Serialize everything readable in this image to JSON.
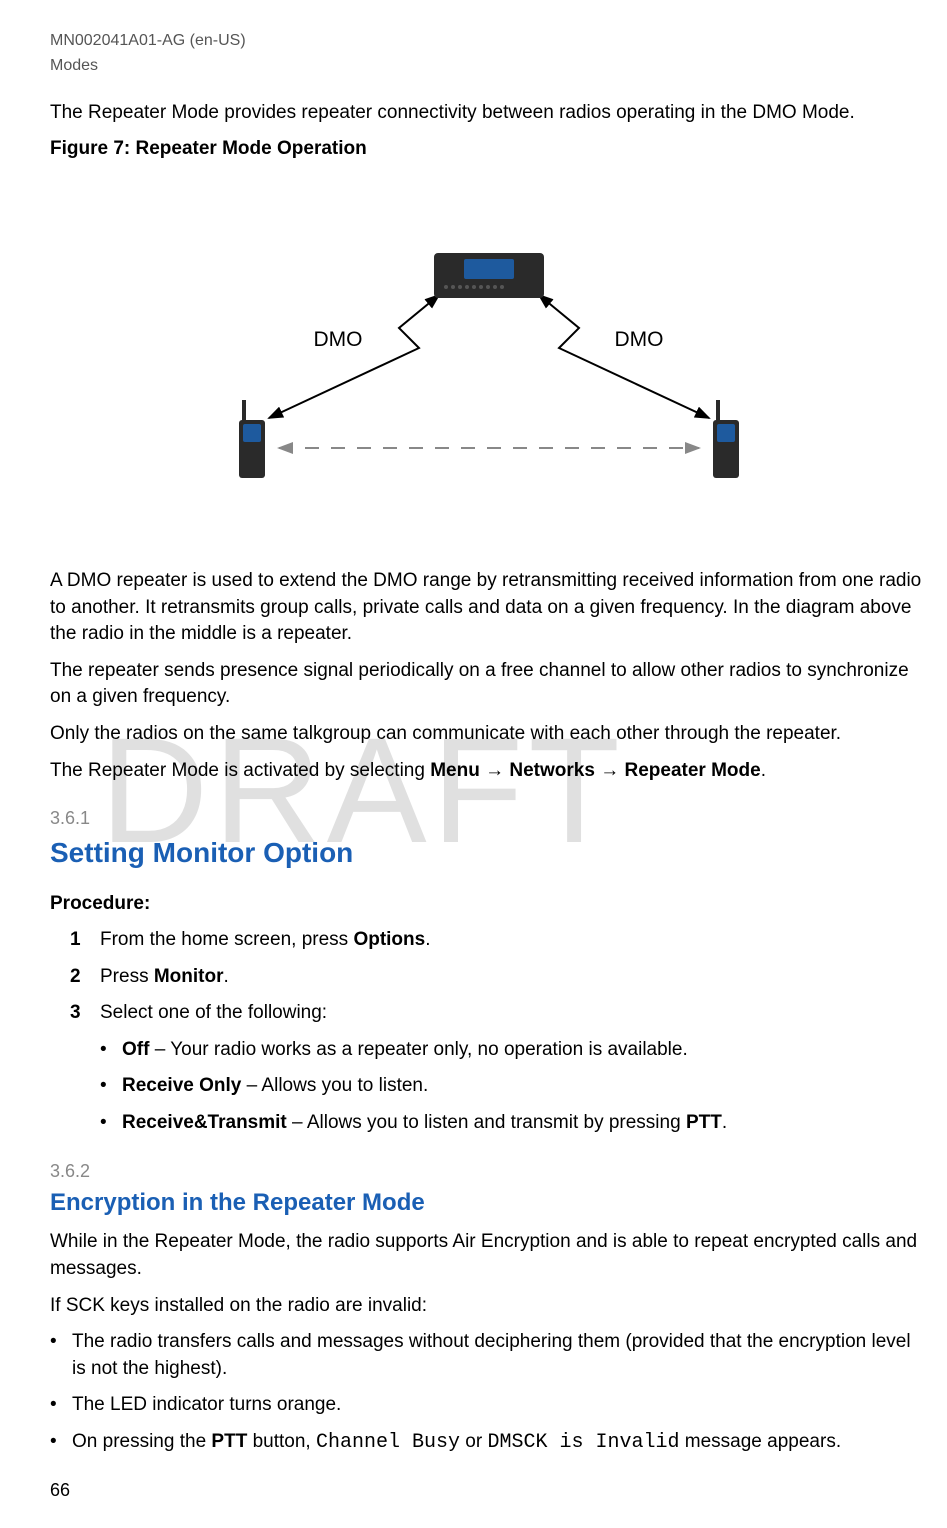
{
  "header": {
    "doc_id": "MN002041A01-AG (en-US)",
    "section": "Modes"
  },
  "page_number": "66",
  "watermark": "DRAFT",
  "intro_text": "The Repeater Mode provides repeater connectivity between radios operating in the DMO Mode.",
  "figure_title": "Figure 7: Repeater Mode Operation",
  "diagram": {
    "label_left": "DMO",
    "label_right": "DMO"
  },
  "para1": "A DMO repeater is used to extend the DMO range by retransmitting received information from one radio to another. It retransmits group calls, private calls and data on a given frequency. In the diagram above the radio in the middle is a repeater.",
  "para2": "The repeater sends presence signal periodically on a free channel to allow other radios to synchronize on a given frequency.",
  "para3": "Only the radios on the same talkgroup can communicate with each other through the repeater.",
  "para4_pre": "The Repeater Mode is activated by selecting ",
  "para4_menu": "Menu",
  "para4_arrow1": " → ",
  "para4_networks": "Networks",
  "para4_arrow2": " → ",
  "para4_repeater": "Repeater Mode",
  "para4_post": ".",
  "section_361": {
    "num": "3.6.1",
    "title": "Setting Monitor Option",
    "procedure_label": "Procedure:",
    "step1_num": "1",
    "step1_pre": "From the home screen, press ",
    "step1_bold": "Options",
    "step1_post": ".",
    "step2_num": "2",
    "step2_pre": "Press ",
    "step2_bold": "Monitor",
    "step2_post": ".",
    "step3_num": "3",
    "step3_text": "Select one of the following:",
    "opt1_bold": "Off",
    "opt1_text": " – Your radio works as a repeater only, no operation is available.",
    "opt2_bold": "Receive Only",
    "opt2_text": " – Allows you to listen.",
    "opt3_bold": "Receive&Transmit",
    "opt3_mid": " – Allows you to listen and transmit by pressing ",
    "opt3_bold2": "PTT",
    "opt3_post": "."
  },
  "section_362": {
    "num": "3.6.2",
    "title": "Encryption in the Repeater Mode",
    "para1": "While in the Repeater Mode, the radio supports Air Encryption and is able to repeat encrypted calls and messages.",
    "para2": "If SCK keys installed on the radio are invalid:",
    "b1": "The radio transfers calls and messages without deciphering them (provided that the encryption level is not the highest).",
    "b2": "The LED indicator turns orange.",
    "b3_pre": "On pressing the ",
    "b3_ptt": "PTT",
    "b3_mid1": " button, ",
    "b3_mono1": "Channel Busy",
    "b3_or": " or ",
    "b3_mono2": "DMSCK is Invalid",
    "b3_post": " message appears."
  }
}
